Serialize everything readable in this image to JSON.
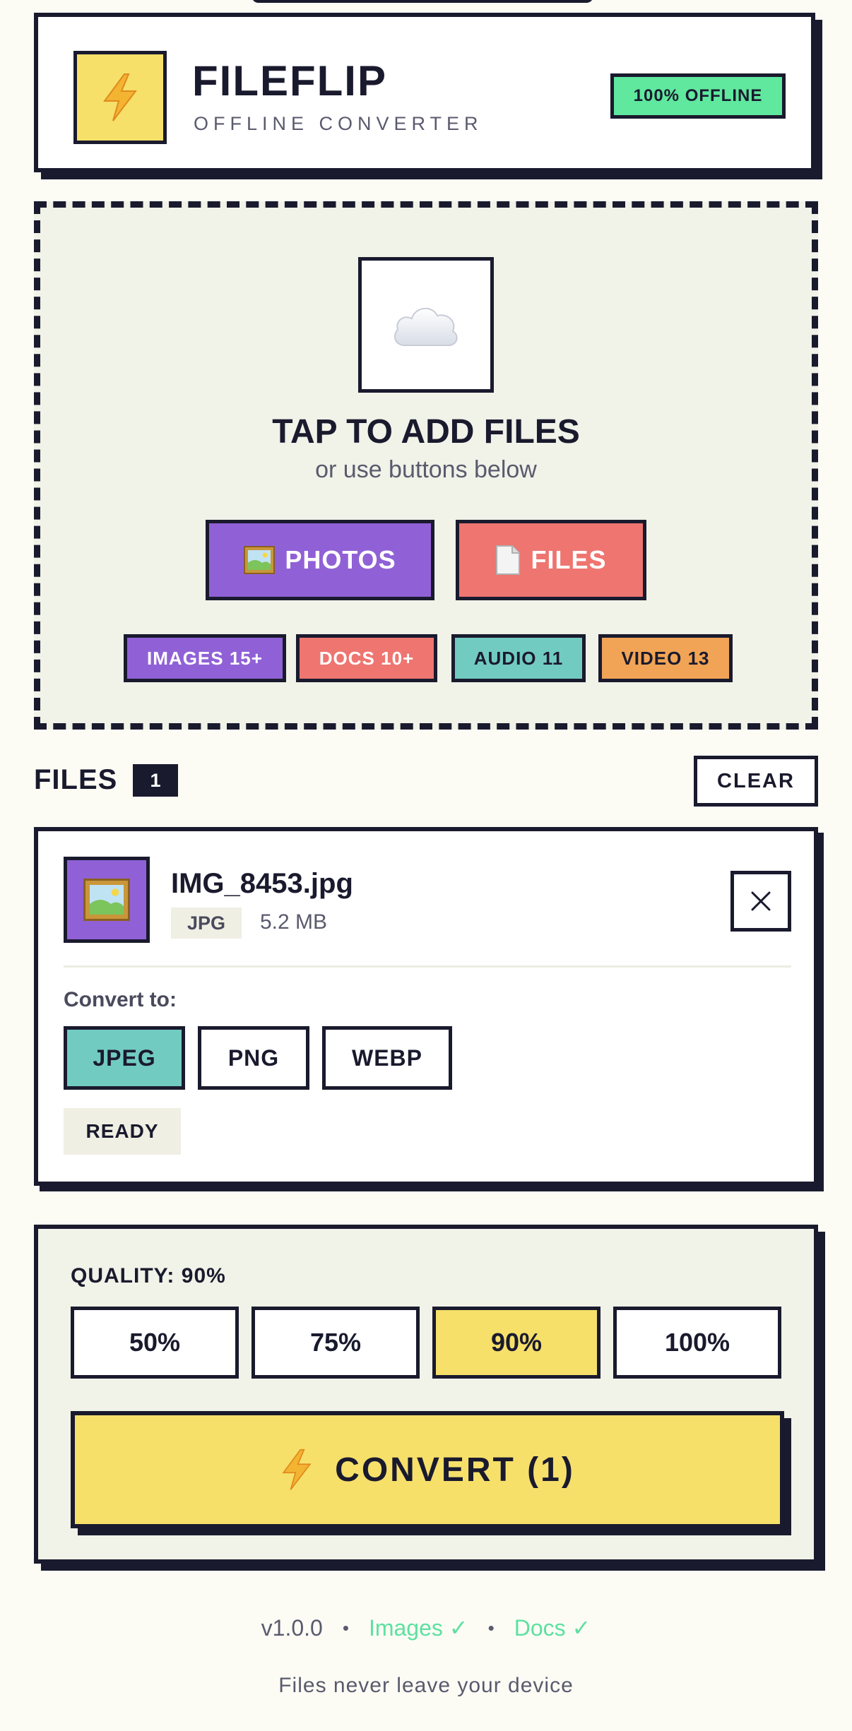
{
  "header": {
    "title": "FILEFLIP",
    "subtitle": "OFFLINE CONVERTER",
    "badge": "100% OFFLINE"
  },
  "dropzone": {
    "title": "TAP TO ADD FILES",
    "subtitle": "or use buttons below",
    "buttons": {
      "photos": "PHOTOS",
      "files": "FILES"
    },
    "categories": [
      "IMAGES 15+",
      "DOCS 10+",
      "AUDIO 11",
      "VIDEO 13"
    ]
  },
  "files": {
    "heading": "FILES",
    "count": "1",
    "clear_label": "CLEAR",
    "items": [
      {
        "name": "IMG_8453.jpg",
        "type": "JPG",
        "size": "5.2 MB",
        "convert_label": "Convert to:",
        "formats": [
          "JPEG",
          "PNG",
          "WEBP"
        ],
        "selected_format": "JPEG",
        "status": "READY"
      }
    ]
  },
  "quality": {
    "label": "QUALITY: 90%",
    "options": [
      "50%",
      "75%",
      "90%",
      "100%"
    ],
    "selected": "90%"
  },
  "convert": {
    "label": "CONVERT (1)"
  },
  "footer": {
    "version": "v1.0.0",
    "images": "Images ✓",
    "docs": "Docs ✓",
    "note": "Files never leave your device"
  },
  "colors": {
    "ink": "#1a1a2e",
    "yellow": "#f6e06a",
    "purple": "#9061d6",
    "coral": "#ee7570",
    "teal": "#72cbc0",
    "orange": "#f1a455",
    "green": "#5fe89e"
  },
  "icons": {
    "logo": "lightning-icon",
    "drop": "cloud-icon",
    "photos": "picture-icon",
    "files": "document-icon",
    "thumb": "picture-icon",
    "remove": "close-icon",
    "convert": "lightning-icon"
  }
}
